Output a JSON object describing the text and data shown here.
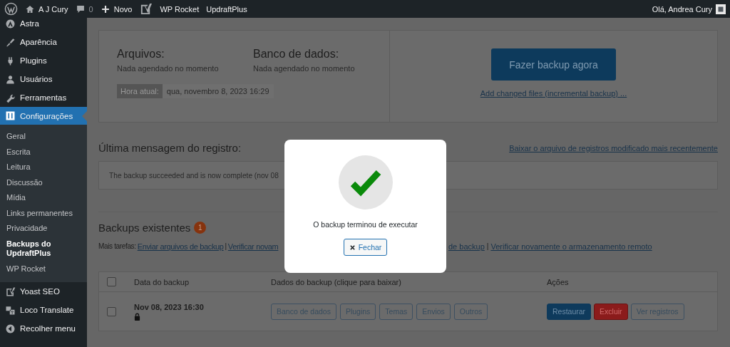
{
  "admin_bar": {
    "site": "A J Cury",
    "comments": "0",
    "new": "Novo",
    "items": [
      "WP Rocket",
      "UpdraftPlus"
    ],
    "greeting": "Olá, Andrea Cury"
  },
  "sidebar": {
    "items": [
      {
        "label": "Astra",
        "selected": false
      },
      {
        "label": "Aparência",
        "selected": false
      },
      {
        "label": "Plugins",
        "selected": false
      },
      {
        "label": "Usuários",
        "selected": false
      },
      {
        "label": "Ferramentas",
        "selected": false
      },
      {
        "label": "Configurações",
        "selected": true,
        "children": [
          {
            "label": "Geral",
            "selected": false
          },
          {
            "label": "Escrita",
            "selected": false
          },
          {
            "label": "Leitura",
            "selected": false
          },
          {
            "label": "Discussão",
            "selected": false
          },
          {
            "label": "Mídia",
            "selected": false
          },
          {
            "label": "Links permanentes",
            "selected": false
          },
          {
            "label": "Privacidade",
            "selected": false
          },
          {
            "label": "Backups do UpdraftPlus",
            "selected": true
          },
          {
            "label": "WP Rocket",
            "selected": false
          }
        ]
      },
      {
        "label": "Yoast SEO",
        "selected": false
      },
      {
        "label": "Loco Translate",
        "selected": false
      },
      {
        "label": "Recolher menu",
        "selected": false
      }
    ]
  },
  "schedule": {
    "files_title": "Arquivos:",
    "files_status": "Nada agendado no momento",
    "db_title": "Banco de dados:",
    "db_status": "Nada agendado no momento",
    "time_label": "Hora atual:",
    "time_value": "qua, novembro 8, 2023 16:29",
    "backup_button": "Fazer backup agora",
    "incremental_link": "Add changed files (incremental backup) ..."
  },
  "log": {
    "title": "Última mensagem do registro:",
    "download_link": "Baixar o arquivo de registros modificado mais recentemente",
    "message": "The backup succeeded and is now complete (nov 08"
  },
  "backups": {
    "title": "Backups existentes",
    "count": "1",
    "tasks_label": "Mais tarefas:",
    "tasks_left": [
      {
        "kind": "link",
        "text": "Enviar arquivos de backup"
      },
      {
        "kind": "separator",
        "text": "|"
      },
      {
        "kind": "link",
        "text": "Verificar novam"
      }
    ],
    "tasks_right": [
      {
        "kind": "link",
        "text": "de backup"
      },
      {
        "kind": "separator",
        "text": "|"
      },
      {
        "kind": "link",
        "text": "Verificar novamente o armazenamento remoto"
      }
    ],
    "table": {
      "select_all_checked": false,
      "columns": [
        "Data do backup",
        "Dados do backup (clique para baixar)",
        "Ações"
      ],
      "rows": [
        {
          "checked": false,
          "date": "Nov 08, 2023 16:30",
          "locked": true,
          "data_buttons": [
            "Banco de dados",
            "Plugins",
            "Temas",
            "Envios",
            "Outros"
          ],
          "actions": [
            {
              "label": "Restaurar",
              "kind": "primary"
            },
            {
              "label": "Excluir",
              "kind": "danger"
            },
            {
              "label": "Ver registros",
              "kind": "default"
            }
          ]
        }
      ]
    }
  },
  "dialog": {
    "message": "O backup terminou de executar",
    "close_button": "Fechar"
  }
}
